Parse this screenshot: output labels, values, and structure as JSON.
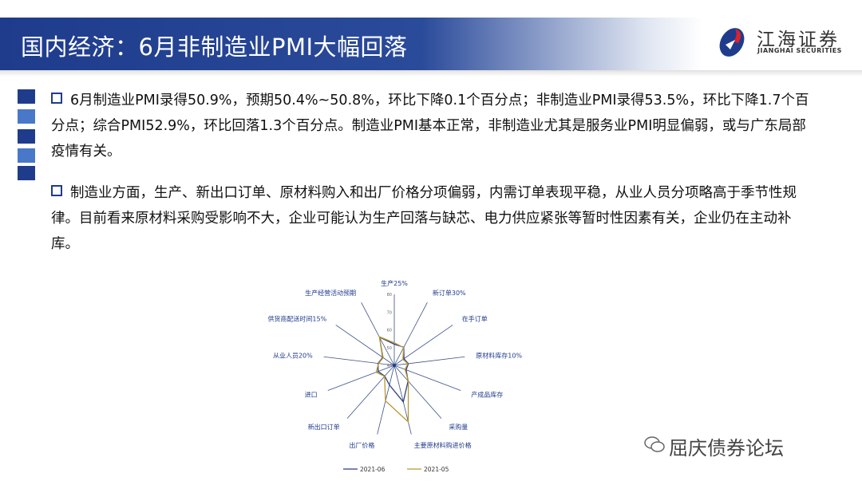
{
  "header": {
    "title": "国内经济：6月非制造业PMI大幅回落",
    "logo_cn": "江海证券",
    "logo_en": "JIANGHAI SECURITIES"
  },
  "paragraphs": [
    "6月制造业PMI录得50.9%，预期50.4%~50.8%，环比下降0.1个百分点；非制造业PMI录得53.5%，环比下降1.7个百分点；综合PMI52.9%，环比回落1.3个百分点。制造业PMI基本正常，非制造业尤其是服务业PMI明显偏弱，或与广东局部疫情有关。",
    "制造业方面，生产、新出口订单、原材料购入和出厂价格分项偏弱，内需订单表现平稳，从业人员分项略高于季节性规律。目前看来原材料采购受影响不大，企业可能认为生产回落与缺芯、电力供应紧张等暂时性因素有关，企业仍在主动补库。"
  ],
  "chart_data": {
    "type": "radar",
    "categories": [
      "生产25%",
      "新订单30%",
      "在手订单",
      "原材料库存10%",
      "产成品库存",
      "采购量",
      "主要原材料购进价格",
      "出厂价格",
      "新出口订单",
      "进口",
      "从业人员20%",
      "供货商配送时间15%",
      "生产经营活动预期"
    ],
    "range": [
      40,
      80
    ],
    "ticks": [
      40,
      50,
      60,
      70,
      80
    ],
    "series": [
      {
        "name": "2021-06",
        "color": "#2b3f7f",
        "values": [
          51.9,
          51.5,
          46.6,
          48.0,
          47.1,
          51.7,
          61.2,
          51.4,
          48.1,
          49.7,
          49.2,
          47.9,
          57.9
        ]
      },
      {
        "name": "2021-05",
        "color": "#b8962e",
        "values": [
          52.7,
          51.3,
          45.9,
          47.7,
          46.5,
          51.9,
          72.8,
          60.6,
          48.3,
          50.9,
          48.9,
          47.6,
          58.2
        ]
      }
    ],
    "legend": "bottom"
  },
  "watermark": "屈庆债券论坛"
}
